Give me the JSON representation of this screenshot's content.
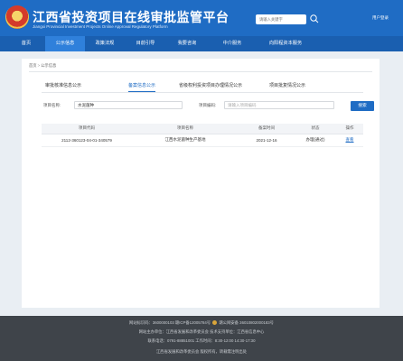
{
  "header": {
    "title": "江西省投资项目在线审批监管平台",
    "subtitle": "Jiangxi Provincial Investment Projects Online Approval Regulatory Platform",
    "search_placeholder": "请输入关键字",
    "account_link": "用户登录"
  },
  "nav": [
    "首页",
    "公示信息",
    "政策法规",
    "目前引导",
    "我要咨询",
    "中介服务",
    "向阳程资本服务"
  ],
  "breadcrumb": [
    "首页",
    "公示信息"
  ],
  "tabs": [
    "审批核准信息公示",
    "备案信息公示",
    "省级权利投资项目办理情况公示",
    "项目批复情况公示"
  ],
  "form": {
    "project_name_label": "项目名称:",
    "project_name_value": "水泥菌种",
    "project_code_label": "项目编码:",
    "project_code_placeholder": "请输入项目编码",
    "search_button": "搜索"
  },
  "table": {
    "columns": [
      "项目代码",
      "项目名称",
      "备案时间",
      "状态",
      "操作"
    ],
    "rows": [
      [
        "2112-360123-04-01-340579",
        "江西水泥菌种生产基地",
        "2021-12-16",
        "办理(通过)",
        "查看"
      ]
    ]
  },
  "footer": {
    "line1": "网站标识码：3600000103 赣ICP备12005784号",
    "line1b": "赣公网安备 36010802000183号",
    "line2": "网站主办单位：江西省发展和改革委员会 技术支持单位：江西省信息中心",
    "line3": "联系电话：0791-88851001 工作时间：8:30-12:00 14:30-17:30",
    "line4": "江西省发展和改革委员会 版权所有，转载需注明出处"
  }
}
